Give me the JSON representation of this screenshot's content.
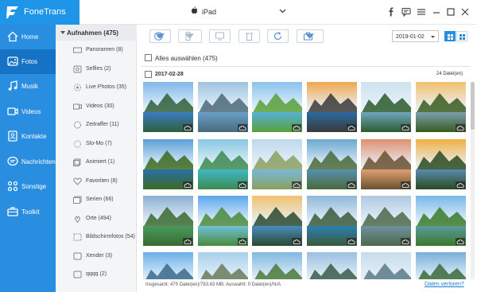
{
  "app": {
    "name": "FoneTrans"
  },
  "device": {
    "name": "iPad"
  },
  "sidebar": {
    "items": [
      {
        "label": "Home",
        "icon": "home-icon"
      },
      {
        "label": "Fotos",
        "icon": "photo-icon",
        "active": true
      },
      {
        "label": "Musik",
        "icon": "music-icon"
      },
      {
        "label": "Videos",
        "icon": "video-icon"
      },
      {
        "label": "Kontakte",
        "icon": "contacts-icon"
      },
      {
        "label": "Nachrichten",
        "icon": "messages-icon"
      },
      {
        "label": "Sonstige",
        "icon": "other-icon"
      },
      {
        "label": "Toolkit",
        "icon": "toolkit-icon"
      }
    ]
  },
  "albums": {
    "header": "Aufnahmen (475)",
    "items": [
      {
        "label": "Panoramen (8)",
        "icon": "panorama-icon"
      },
      {
        "label": "Selfies (2)",
        "icon": "selfie-icon"
      },
      {
        "label": "Live Photos (35)",
        "icon": "live-photo-icon"
      },
      {
        "label": "Videos (30)",
        "icon": "video-icon"
      },
      {
        "label": "Zeitraffer (11)",
        "icon": "timelapse-icon"
      },
      {
        "label": "Slo-Mo (7)",
        "icon": "slomo-icon"
      },
      {
        "label": "Animiert (1)",
        "icon": "animated-icon"
      },
      {
        "label": "Favoriten (8)",
        "icon": "heart-icon"
      },
      {
        "label": "Serien (66)",
        "icon": "burst-icon"
      },
      {
        "label": "Orte (494)",
        "icon": "location-icon"
      },
      {
        "label": "Bildschirmfotos (54)",
        "icon": "screenshot-icon"
      },
      {
        "label": "Xender (3)",
        "icon": "album-icon"
      },
      {
        "label": "qqqq (2)",
        "icon": "album-icon"
      }
    ]
  },
  "toolbar": {
    "buttons": [
      "add-icon",
      "export-device-icon",
      "export-pc-icon",
      "delete-icon",
      "refresh-icon",
      "toolbox-icon"
    ]
  },
  "filter": {
    "date_value": "2019-01-02"
  },
  "select_all": {
    "label": "Alles auswählen (475)"
  },
  "group": {
    "date": "2017-02-28",
    "count": "24 Datei(en)"
  },
  "status": {
    "text": "Insgesamt: 475 Datei(en)/783.63 MB; Auswahlt: 0 Datei(en)/N/A",
    "lost_link": "Daten verloren?"
  },
  "colors": {
    "accent": "#2a8ee0",
    "sidebar_active": "#1672c4"
  }
}
